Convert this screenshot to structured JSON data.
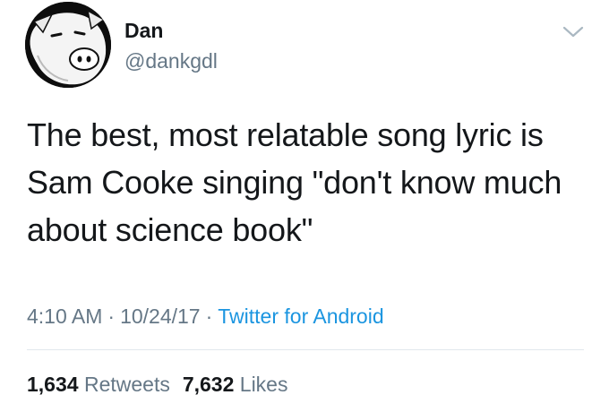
{
  "author": {
    "name": "Dan",
    "handle": "@dankgdl",
    "avatar_icon": "pig-face-avatar-icon"
  },
  "menu": {
    "icon": "chevron-down-icon"
  },
  "tweet": {
    "text": "The best, most relatable song lyric is Sam Cooke singing \"don't know much about science book\"",
    "time": "4:10 AM",
    "separator": "·",
    "date": "10/24/17",
    "source": "Twitter for Android"
  },
  "stats": {
    "retweets_count": "1,634",
    "retweets_label": "Retweets",
    "likes_count": "7,632",
    "likes_label": "Likes"
  },
  "colors": {
    "text": "#14171a",
    "secondary": "#657786",
    "link": "#1b95e0",
    "divider": "#e1e8ed"
  }
}
